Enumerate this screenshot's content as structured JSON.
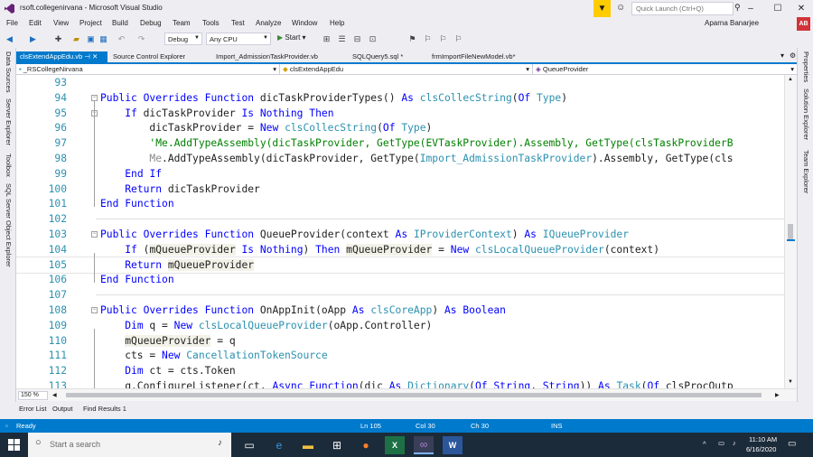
{
  "window": {
    "title": "rsoft.collegenirvana - Microsoft Visual Studio",
    "quick_launch_placeholder": "Quick Launch (Ctrl+Q)",
    "user_name": "Aparna Banarjee",
    "avatar_initials": "AB",
    "accent_color": "#007acc"
  },
  "menu": [
    "File",
    "Edit",
    "View",
    "Project",
    "Build",
    "Debug",
    "Team",
    "Tools",
    "Test",
    "Analyze",
    "Window",
    "Help"
  ],
  "toolbar": {
    "config": "Debug",
    "platform": "Any CPU",
    "start_label": "Start"
  },
  "left_rail": [
    "Data Sources",
    "Server Explorer",
    "Toolbox",
    "SQL Server Object Explorer"
  ],
  "right_rail": [
    "Properties",
    "Solution Explorer",
    "Team Explorer"
  ],
  "doc_tabs": [
    {
      "label": "clsExtendAppEdu.vb",
      "active": true
    },
    {
      "label": "Source Control Explorer",
      "active": false
    },
    {
      "label": "Import_AdmissionTaskProvider.vb",
      "active": false
    },
    {
      "label": "SQLQuery5.sql *",
      "active": false
    },
    {
      "label": "frmImportFileNewModel.vb*",
      "active": false
    }
  ],
  "nav": {
    "project": "_RSCollegeNirvana",
    "class": "clsExtendAppEdu",
    "member": "QueueProvider"
  },
  "editor": {
    "zoom": "150 %",
    "lines": [
      {
        "n": "93",
        "text": ""
      },
      {
        "n": "94",
        "text": "Public Overrides Function dicTaskProviderTypes() As clsCollecString(Of Type)"
      },
      {
        "n": "95",
        "text": "    If dicTaskProvider Is Nothing Then"
      },
      {
        "n": "96",
        "text": "        dicTaskProvider = New clsCollecString(Of Type)"
      },
      {
        "n": "97",
        "text": "        'Me.AddTypeAssembly(dicTaskProvider, GetType(EVTaskProvider).Assembly, GetType(clsTaskProviderB"
      },
      {
        "n": "98",
        "text": "        Me.AddTypeAssembly(dicTaskProvider, GetType(Import_AdmissionTaskProvider).Assembly, GetType(cls"
      },
      {
        "n": "99",
        "text": "    End If"
      },
      {
        "n": "100",
        "text": "    Return dicTaskProvider"
      },
      {
        "n": "101",
        "text": "End Function"
      },
      {
        "n": "102",
        "text": ""
      },
      {
        "n": "103",
        "text": "Public Overrides Function QueueProvider(context As IProviderContext) As IQueueProvider"
      },
      {
        "n": "104",
        "text": "    If (mQueueProvider Is Nothing) Then mQueueProvider = New clsLocalQueueProvider(context)"
      },
      {
        "n": "105",
        "text": "    Return mQueueProvider"
      },
      {
        "n": "106",
        "text": "End Function"
      },
      {
        "n": "107",
        "text": ""
      },
      {
        "n": "108",
        "text": "Public Overrides Function OnAppInit(oApp As clsCoreApp) As Boolean"
      },
      {
        "n": "109",
        "text": "    Dim q = New clsLocalQueueProvider(oApp.Controller)"
      },
      {
        "n": "110",
        "text": "    mQueueProvider = q"
      },
      {
        "n": "111",
        "text": "    cts = New CancellationTokenSource"
      },
      {
        "n": "112",
        "text": "    Dim ct = cts.Token"
      },
      {
        "n": "113",
        "text": "    q.ConfigureListener(ct, Async Function(dic As Dictionary(Of String, String)) As Task(Of clsProcOutp"
      }
    ]
  },
  "bottom_tabs": [
    "Error List",
    "Output",
    "Find Results 1"
  ],
  "status": {
    "state": "Ready",
    "line": "Ln 105",
    "col": "Col 30",
    "ch": "Ch 30",
    "mode": "INS"
  },
  "taskbar": {
    "search_placeholder": "Start a search",
    "time": "11:10 AM",
    "date": "6/16/2020"
  }
}
